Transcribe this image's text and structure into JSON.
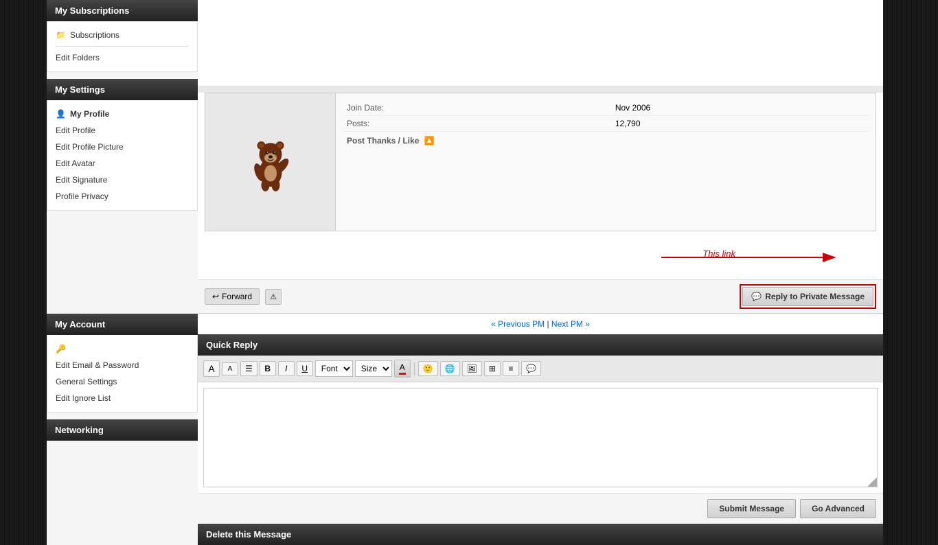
{
  "sidebar": {
    "my_subscriptions_header": "My Subscriptions",
    "subscriptions_label": "Subscriptions",
    "edit_folders_label": "Edit Folders",
    "my_settings_header": "My Settings",
    "my_profile_label": "My Profile",
    "edit_profile_label": "Edit Profile",
    "edit_profile_picture_label": "Edit Profile Picture",
    "edit_avatar_label": "Edit Avatar",
    "edit_signature_label": "Edit Signature",
    "profile_privacy_label": "Profile Privacy",
    "my_account_header": "My Account",
    "edit_email_password_label": "Edit Email & Password",
    "general_settings_label": "General Settings",
    "edit_ignore_list_label": "Edit Ignore List",
    "networking_label": "Networking"
  },
  "post": {
    "join_date_label": "Join Date:",
    "join_date_value": "Nov 2006",
    "posts_label": "Posts:",
    "posts_value": "12,790",
    "post_thanks_label": "Post Thanks / Like",
    "annotation_text": "This link",
    "forward_btn": "Forward",
    "reply_pm_btn": "Reply to Private Message"
  },
  "navigation": {
    "prev_label": "« Previous PM",
    "separator": "|",
    "next_label": "Next PM »"
  },
  "quick_reply": {
    "header": "Quick Reply",
    "font_label": "Font",
    "size_label": "Size",
    "submit_btn": "Submit Message",
    "go_advanced_btn": "Go Advanced"
  },
  "delete_section": {
    "header": "Delete this Message"
  }
}
